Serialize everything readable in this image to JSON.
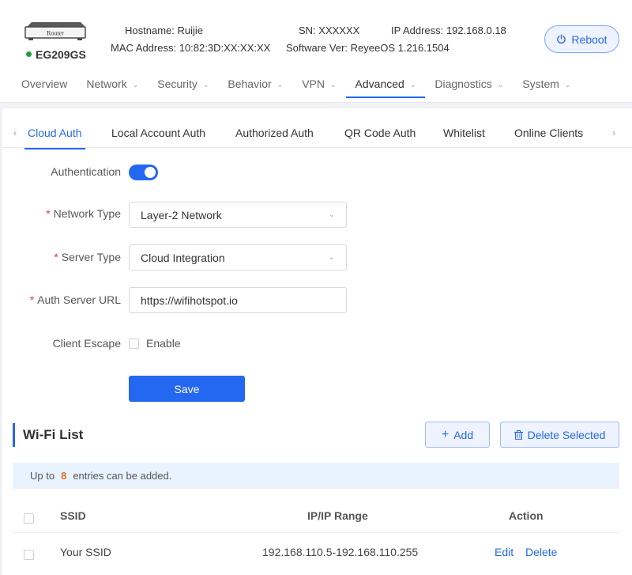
{
  "device": {
    "router_label": "Router",
    "model": "EG209GS",
    "hostname_label": "Hostname:",
    "hostname": "Ruijie",
    "mac_label": "MAC Address:",
    "mac": "10:82:3D:XX:XX:XX",
    "sn_label": "SN:",
    "sn": "XXXXXX",
    "software_label": "Software Ver:",
    "software": "ReyeeOS 1.216.1504",
    "ip_label": "IP Address:",
    "ip": "192.168.0.18",
    "reboot_label": "Reboot",
    "status_color": "#1e9e3e"
  },
  "nav": {
    "items": [
      "Overview",
      "Network",
      "Security",
      "Behavior",
      "VPN",
      "Advanced",
      "Diagnostics",
      "System"
    ],
    "active": "Advanced"
  },
  "tabs": {
    "items": [
      "Cloud Auth",
      "Local Account Auth",
      "Authorized Auth",
      "QR Code Auth",
      "Whitelist",
      "Online Clients"
    ],
    "active": "Cloud Auth"
  },
  "form": {
    "authentication_label": "Authentication",
    "authentication_enabled": true,
    "network_type_label": "Network Type",
    "network_type_value": "Layer-2 Network",
    "server_type_label": "Server Type",
    "server_type_value": "Cloud Integration",
    "auth_url_label": "Auth Server URL",
    "auth_url_value": "https://wifihotspot.io",
    "client_escape_label": "Client Escape",
    "client_escape_option": "Enable",
    "required_mark": "*",
    "save_label": "Save"
  },
  "wifi": {
    "title": "Wi-Fi List",
    "add_label": "Add",
    "delete_selected_label": "Delete Selected",
    "notice_prefix": "Up to",
    "notice_count": "8",
    "notice_suffix": "entries can be added.",
    "columns": [
      "SSID",
      "IP/IP Range",
      "Action"
    ],
    "rows": [
      {
        "ssid": "Your SSID",
        "ip_range": "192.168.110.5-192.168.110.255",
        "edit": "Edit",
        "delete": "Delete"
      }
    ]
  },
  "colors": {
    "accent": "#2467f0",
    "required": "#e53935",
    "notice_count": "#e8711f",
    "notice_bg": "#e8f3ff"
  }
}
